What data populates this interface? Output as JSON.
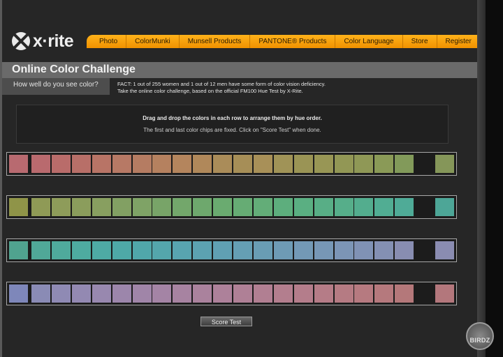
{
  "brand": {
    "logo_text": "x·rite"
  },
  "nav": {
    "items": [
      {
        "label": "Photo"
      },
      {
        "label": "ColorMunki"
      },
      {
        "label": "Munsell Products"
      },
      {
        "label": "PANTONE® Products"
      },
      {
        "label": "Color Language"
      },
      {
        "label": "Store"
      },
      {
        "label": "Register"
      }
    ]
  },
  "page": {
    "title": "Online Color Challenge",
    "subtitle": "How well do you see color?",
    "fact_line1": "FACT: 1 out of 255 women and 1 out of 12 men have some form of color vision deficiency.",
    "fact_line2": "Take the online color challenge, based on the official FM100 Hue Test by X-Rite."
  },
  "instructions": {
    "line1": "Drag and drop the colors in each row to arrange them by hue order.",
    "line2": "The first and last color chips are fixed. Click on \"Score Test\" when done."
  },
  "rows": [
    {
      "chips": [
        "#b86a70",
        "#b96a6e",
        "#b96c6a",
        "#b86f68",
        "#b87466",
        "#b77965",
        "#b57c62",
        "#b5815f",
        "#b4855d",
        "#b0885a",
        "#aa8c59",
        "#a68e57",
        "#a89058",
        "#a09357",
        "#9a9455",
        "#989655",
        "#929755",
        "#8f9856",
        "#8a9a57",
        "#829a5a",
        "#859659"
      ]
    },
    {
      "chips": [
        "#8f9448",
        "#8f9a56",
        "#8e9c5a",
        "#8b9d5c",
        "#889f60",
        "#82a063",
        "#7fa366",
        "#78a468",
        "#73a76b",
        "#6ea86d",
        "#6aab70",
        "#66ac74",
        "#63ad78",
        "#5dae7d",
        "#5aaf82",
        "#58ae86",
        "#56ae8a",
        "#53ad8e",
        "#51ad93",
        "#4fab97",
        "#4da697"
      ]
    },
    {
      "chips": [
        "#50a38f",
        "#50a898",
        "#4faa9c",
        "#4eaba0",
        "#4eaaa4",
        "#4ea9a7",
        "#50a7aa",
        "#54a6ac",
        "#58a4b0",
        "#5ca2b1",
        "#60a0b3",
        "#659fb4",
        "#699db4",
        "#6e9bb5",
        "#7399b6",
        "#7797b6",
        "#7c95b6",
        "#8092b5",
        "#8490b3",
        "#888db1",
        "#8a8cb1"
      ]
    },
    {
      "chips": [
        "#7e87ba",
        "#8a8bb5",
        "#8f8ab4",
        "#9389b2",
        "#9888af",
        "#9c86ab",
        "#a085a8",
        "#a484a5",
        "#a783a1",
        "#aa829d",
        "#ad819a",
        "#af8096",
        "#b17f92",
        "#b37e8e",
        "#b47d8b",
        "#b57c87",
        "#b57b83",
        "#b67a80",
        "#b5797d",
        "#b4787a",
        "#b3777c"
      ]
    }
  ],
  "score_button": {
    "label": "Score Test"
  },
  "badge": {
    "text": "BIRDZ"
  },
  "colors": {
    "nav_orange": "#f5a00a",
    "panel_bg": "#262626",
    "title_bar": "#6a6a6a"
  }
}
